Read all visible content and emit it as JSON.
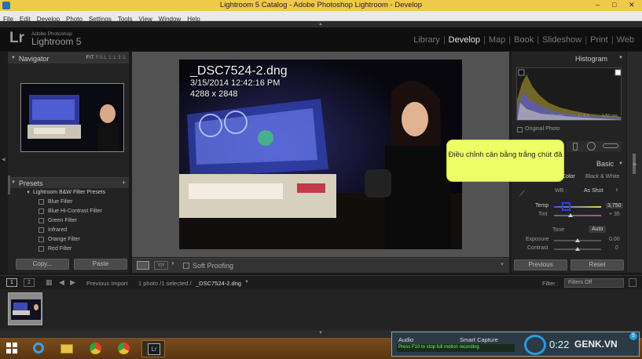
{
  "window": {
    "title": "Lightroom 5 Catalog - Adobe Photoshop Lightroom - Develop",
    "controls": [
      "–",
      "□",
      "✕"
    ]
  },
  "menu": [
    "File",
    "Edit",
    "Develop",
    "Photo",
    "Settings",
    "Tools",
    "View",
    "Window",
    "Help"
  ],
  "identity": {
    "logo": "Lr",
    "adobe": "Adobe Photoshop",
    "product": "Lightroom 5"
  },
  "modules": [
    "Library",
    "Develop",
    "Map",
    "Book",
    "Slideshow",
    "Print",
    "Web"
  ],
  "active_module": "Develop",
  "navigator": {
    "title": "Navigator",
    "zoom_options": [
      "FIT",
      "FILL",
      "1:1",
      "3:1"
    ]
  },
  "presets": {
    "title": "Presets",
    "group": "Lightroom B&W Filter Presets",
    "items": [
      "Blue Filter",
      "Blue Hi-Contrast Filter",
      "Green Filter",
      "Infrared",
      "Orange Filter",
      "Red Filter"
    ]
  },
  "left_buttons": {
    "copy": "Copy...",
    "paste": "Paste"
  },
  "photo": {
    "filename": "_DSC7524-2.dng",
    "datetime": "3/15/2014 12:42:16 PM",
    "dimensions": "4288 x 2848"
  },
  "toolbar": {
    "soft_proofing": "Soft Proofing",
    "view_icon": "Y|Y"
  },
  "histogram": {
    "title": "Histogram",
    "exif": [
      "ISO 800",
      "50 mm",
      "f / 4.5",
      "1/50 sec"
    ],
    "original_photo": "Original Photo"
  },
  "basic": {
    "title": "Basic",
    "treatment_color": "Color",
    "treatment_bw": "Black & White",
    "wb_label": "WB :",
    "wb_value": "As Shot",
    "temp_label": "Temp",
    "temp_value": "3,750",
    "tint_label": "Tint",
    "tint_value": "+ 35",
    "tone_label": "Tone",
    "tone_auto": "Auto",
    "exposure_label": "Exposure",
    "exposure_value": "0.00",
    "contrast_label": "Contrast",
    "contrast_value": "0"
  },
  "right_buttons": {
    "previous": "Previous",
    "reset": "Reset"
  },
  "callout": "Điều chỉnh cân bằng trắng chút đã",
  "filmstrip_bar": {
    "page1": "1",
    "page2": "2",
    "previous_import": "Previous Import",
    "selection": "1 photo /1 selected /",
    "selected_file": "_DSC7524-2.dng",
    "filter_label": "Filter :",
    "filter_value": "Filters Off"
  },
  "recorder": {
    "audio": "Audio",
    "smart_capture": "Smart Capture",
    "hint": "Press F10 to stop full motion recording",
    "time": "0:22",
    "watermark": "GENK.VN",
    "wm_badge": "5"
  },
  "colors": {
    "titlebar": "#f0c84a",
    "panel": "#232323",
    "callout": "#eeff66",
    "active_module": "#e6e6e6"
  }
}
